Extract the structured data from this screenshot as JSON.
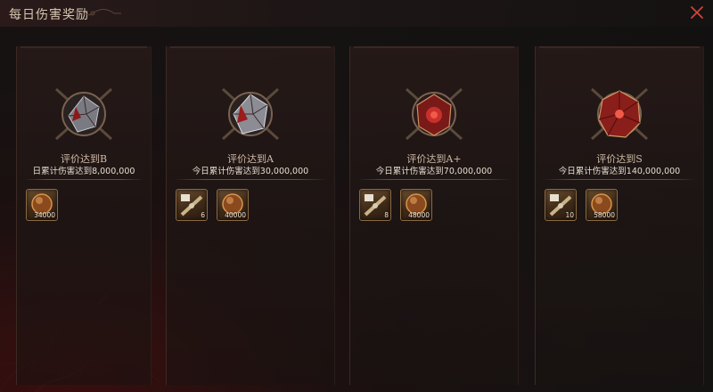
{
  "window": {
    "title": "每日伤害奖励",
    "close_icon": "close-x-icon"
  },
  "colors": {
    "accent_red": "#c8302c",
    "gold_border": "#8a6a44",
    "text_light": "#e6dccf"
  },
  "cards": [
    {
      "grade": "评价达到B",
      "requirement": "日累计伤害达到8,000,000",
      "emblem_icon": "crystal-emblem-b-icon",
      "rewards": [
        {
          "icon": "orb-currency-icon",
          "qty": "34000"
        }
      ]
    },
    {
      "grade": "评价达到A",
      "requirement": "今日累计伤害达到30,000,000",
      "emblem_icon": "crystal-emblem-a-icon",
      "rewards": [
        {
          "icon": "scroll-item-icon",
          "qty": "6"
        },
        {
          "icon": "orb-currency-icon",
          "qty": "40000"
        }
      ]
    },
    {
      "grade": "评价达到A+",
      "requirement": "今日累计伤害达到70,000,000",
      "emblem_icon": "crystal-emblem-a-plus-icon",
      "rewards": [
        {
          "icon": "scroll-item-icon",
          "qty": "8"
        },
        {
          "icon": "orb-currency-icon",
          "qty": "48000"
        }
      ]
    },
    {
      "grade": "评价达到S",
      "requirement": "今日累计伤害达到140,000,000",
      "emblem_icon": "crystal-emblem-s-icon",
      "rewards": [
        {
          "icon": "scroll-item-icon",
          "qty": "10"
        },
        {
          "icon": "orb-currency-icon",
          "qty": "58000"
        }
      ]
    }
  ]
}
